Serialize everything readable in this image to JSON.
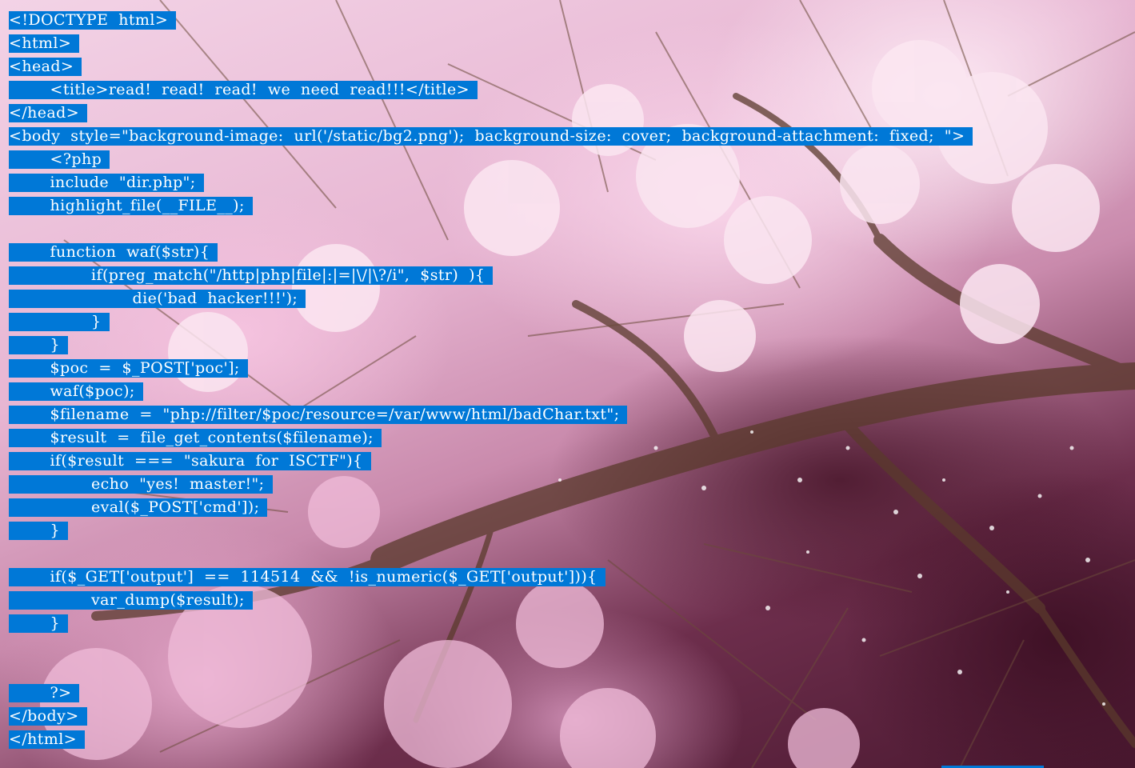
{
  "source_lines": [
    "<!DOCTYPE  html>",
    "<html>",
    "<head>",
    "        <title>read!  read!  read!  we  need  read!!!</title>",
    "</head>",
    "<body  style=\"background-image:  url('/static/bg2.png');  background-size:  cover;  background-attachment:  fixed;  \">",
    "        <?php",
    "        include  \"dir.php\";",
    "        highlight_file(__FILE__);",
    "",
    "        function  waf($str){",
    "                if(preg_match(\"/http|php|file|:|=|\\/|\\?/i\",  $str)  ){",
    "                        die('bad  hacker!!!');",
    "                }",
    "        }",
    "        $poc  =  $_POST['poc'];",
    "        waf($poc);",
    "        $filename  =  \"php://filter/$poc/resource=/var/www/html/badChar.txt\";",
    "        $result  =  file_get_contents($filename);",
    "        if($result  ===  \"sakura  for  ISCTF\"){",
    "                echo  \"yes!  master!\";",
    "                eval($_POST['cmd']);",
    "        }",
    "",
    "        if($_GET['output']  ==  114514  &&  !is_numeric($_GET['output'])){",
    "                var_dump($result);",
    "        }",
    "",
    "",
    "        ?>",
    "</body>",
    "</html>"
  ],
  "colors": {
    "selection": "#0078d7",
    "selection_text": "#ffffff",
    "background_theme": "cherry-blossom"
  }
}
